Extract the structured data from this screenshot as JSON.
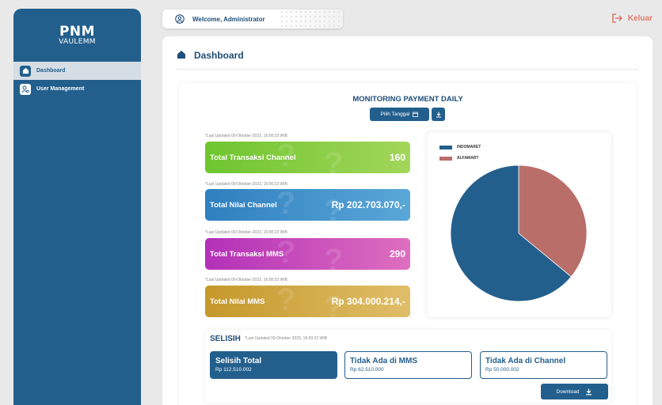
{
  "brand": {
    "line1": "PNM",
    "line2": "VAULЕMM"
  },
  "sidebar": {
    "items": [
      {
        "label": "Dashboard",
        "icon": "home-icon",
        "active": true
      },
      {
        "label": "User Management",
        "icon": "user-gear-icon",
        "active": false
      }
    ]
  },
  "header": {
    "welcome": "Welcome, Administrator",
    "logout_label": "Keluar"
  },
  "page": {
    "title": "Dashboard"
  },
  "monitoring": {
    "title": "MONITORING PAYMENT DAILY",
    "pick_date_label": "Pilih Tanggal"
  },
  "stats": [
    {
      "note": "*Last Updated 09-Oktober-2023, 16:00:23 WIB",
      "label": "Total Transaksi Channel",
      "value": "160",
      "color_start": "#6ec52f",
      "color_end": "#a3d65a"
    },
    {
      "note": "*Last Updated 09-Oktober-2023, 16:00:23 WIB",
      "label": "Total Nilai Channel",
      "value": "Rp 202.703.070,-",
      "color_start": "#2f7fbf",
      "color_end": "#5aa7d8"
    },
    {
      "note": "*Last Updated 09-Oktober-2023, 16:00:23 WIB",
      "label": "Total Transaksi MMS",
      "value": "290",
      "color_start": "#b330b8",
      "color_end": "#de6fbf"
    },
    {
      "note": "*Last Updated 09-Oktober-2023, 16:00:23 WIB",
      "label": "Total Nilai MMS",
      "value": "Rp 304.000.214,-",
      "color_start": "#c4982a",
      "color_end": "#e0be69"
    }
  ],
  "chart_data": {
    "type": "pie",
    "labels": [
      "INDOMARET",
      "ALFAMART"
    ],
    "values": [
      64,
      36
    ],
    "colors": [
      "#235f8c",
      "#b96e6a"
    ],
    "legend": "top-left"
  },
  "selisih": {
    "title": "SELISIH",
    "note": "*Last Updated 09-Oktober-2023, 16:00:23 WIB",
    "boxes": [
      {
        "title": "Selisih Total",
        "value": "Rp 112.510.002"
      },
      {
        "title": "Tidak Ada di MMS",
        "value": "Rp 62.510.000"
      },
      {
        "title": "Tidak Ada di Channel",
        "value": "Rp 50.000.002"
      }
    ],
    "download_label": "Download"
  }
}
